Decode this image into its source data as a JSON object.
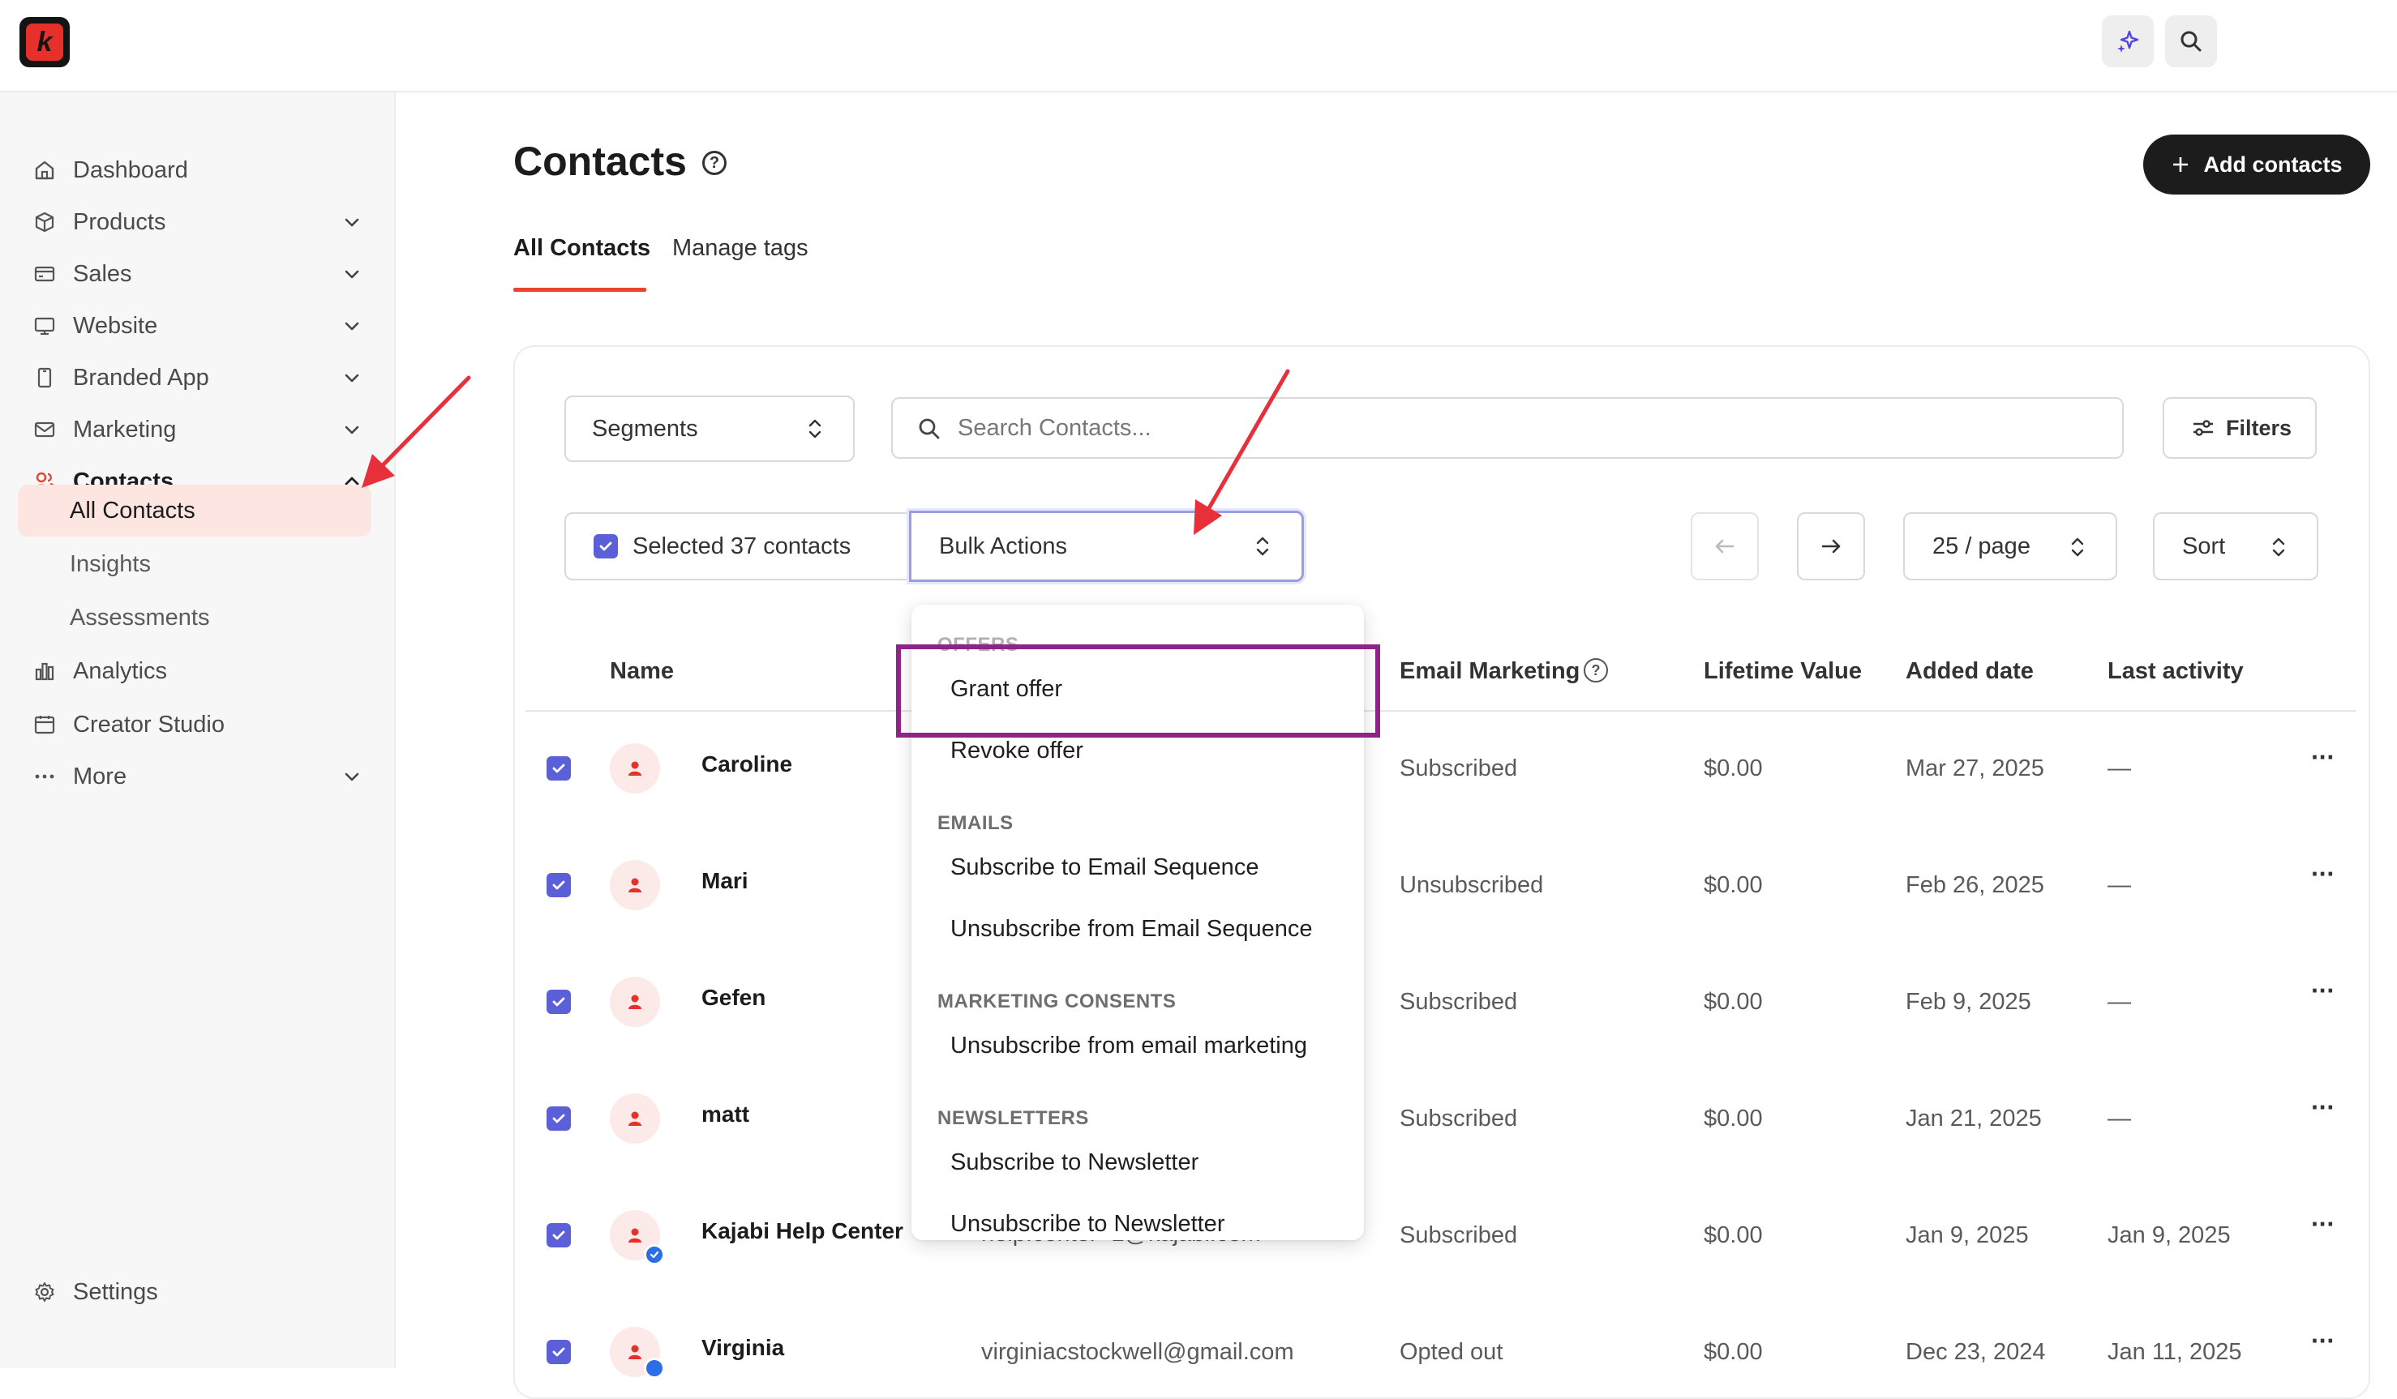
{
  "topbar": {
    "logo_letter": "k",
    "icons": [
      "sparkle-icon",
      "search-icon"
    ]
  },
  "sidebar": {
    "items": [
      {
        "label": "Dashboard",
        "icon": "home-icon"
      },
      {
        "label": "Products",
        "icon": "box-icon"
      },
      {
        "label": "Sales",
        "icon": "credit-card-icon"
      },
      {
        "label": "Website",
        "icon": "monitor-icon"
      },
      {
        "label": "Branded App",
        "icon": "phone-icon"
      },
      {
        "label": "Marketing",
        "icon": "mail-icon"
      },
      {
        "label": "Contacts",
        "icon": "users-icon"
      },
      {
        "label": "Analytics",
        "icon": "bar-chart-icon"
      },
      {
        "label": "Creator Studio",
        "icon": "calendar-icon"
      },
      {
        "label": "More",
        "icon": "dots-icon"
      }
    ],
    "sub_items": [
      "All Contacts",
      "Insights",
      "Assessments"
    ],
    "settings_label": "Settings"
  },
  "page": {
    "title": "Contacts",
    "add_button": "Add contacts",
    "tabs": [
      "All Contacts",
      "Manage tags"
    ]
  },
  "controls": {
    "segments": "Segments",
    "search_placeholder": "Search Contacts...",
    "filters": "Filters",
    "selected": "Selected 37 contacts",
    "bulk_actions": "Bulk Actions",
    "per_page": "25 / page",
    "sort": "Sort"
  },
  "table": {
    "columns": [
      "Name",
      "Email Marketing",
      "Lifetime Value",
      "Added date",
      "Last activity"
    ],
    "rows": [
      {
        "name": "Caroline",
        "email": "",
        "marketing": "Subscribed",
        "value": "$0.00",
        "added": "Mar 27, 2025",
        "last": "—"
      },
      {
        "name": "Mari",
        "email": "",
        "marketing": "Unsubscribed",
        "value": "$0.00",
        "added": "Feb 26, 2025",
        "last": "—"
      },
      {
        "name": "Gefen",
        "email": "",
        "marketing": "Subscribed",
        "value": "$0.00",
        "added": "Feb 9, 2025",
        "last": "—"
      },
      {
        "name": "matt",
        "email": "",
        "marketing": "Subscribed",
        "value": "$0.00",
        "added": "Jan 21, 2025",
        "last": "—"
      },
      {
        "name": "Kajabi Help Center",
        "email": "help.center+1@kajabi.com",
        "marketing": "Subscribed",
        "value": "$0.00",
        "added": "Jan 9, 2025",
        "last": "Jan 9, 2025"
      },
      {
        "name": "Virginia",
        "email": "virginiacstockwell@gmail.com",
        "marketing": "Opted out",
        "value": "$0.00",
        "added": "Dec 23, 2024",
        "last": "Jan 11, 2025"
      }
    ],
    "row_menu": "···"
  },
  "dropdown": {
    "offers_heading": "OFFERS",
    "grant_offer": "Grant offer",
    "revoke_offer": "Revoke offer",
    "emails_heading": "EMAILS",
    "subscribe_seq": "Subscribe to Email Sequence",
    "unsubscribe_seq": "Unsubscribe from Email Sequence",
    "consents_heading": "MARKETING CONSENTS",
    "unsubscribe_marketing": "Unsubscribe from email marketing",
    "newsletters_heading": "NEWSLETTERS",
    "subscribe_newsletter": "Subscribe to Newsletter",
    "unsubscribe_newsletter": "Unsubscribe to Newsletter"
  },
  "colors": {
    "accent": "#e8452f",
    "checkbox": "#5b5fd8",
    "highlight": "#8e2389",
    "annotation_arrow": "#e8303b"
  }
}
